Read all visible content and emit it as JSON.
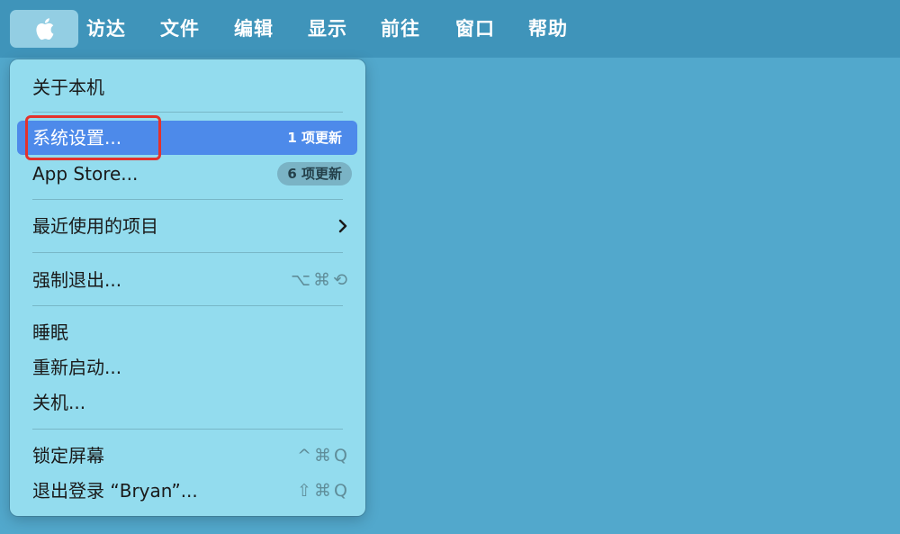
{
  "colors": {
    "desktop": "#52a8cc",
    "menubar": "#3f94ba",
    "menu_background": "#93dcee",
    "selection": "#4d8aea",
    "annotation_box": "#e3322c"
  },
  "menubar": {
    "apple_icon": "apple-icon",
    "items": [
      {
        "label": "访达"
      },
      {
        "label": "文件"
      },
      {
        "label": "编辑"
      },
      {
        "label": "显示"
      },
      {
        "label": "前往"
      },
      {
        "label": "窗口"
      },
      {
        "label": "帮助"
      }
    ]
  },
  "apple_menu": {
    "about": {
      "label": "关于本机"
    },
    "system_settings": {
      "label": "系统设置...",
      "badge": "1 项更新",
      "selected": true
    },
    "app_store": {
      "label": "App Store...",
      "badge": "6 项更新"
    },
    "recent_items": {
      "label": "最近使用的项目",
      "submenu_icon": "chevron-right-icon"
    },
    "force_quit": {
      "label": "强制退出...",
      "shortcut": "⌥⌘⟲"
    },
    "sleep": {
      "label": "睡眠"
    },
    "restart": {
      "label": "重新启动..."
    },
    "shutdown": {
      "label": "关机..."
    },
    "lock_screen": {
      "label": "锁定屏幕",
      "shortcut": "^⌘Q"
    },
    "log_out": {
      "label": "退出登录 “Bryan”...",
      "shortcut": "⇧⌘Q"
    }
  }
}
